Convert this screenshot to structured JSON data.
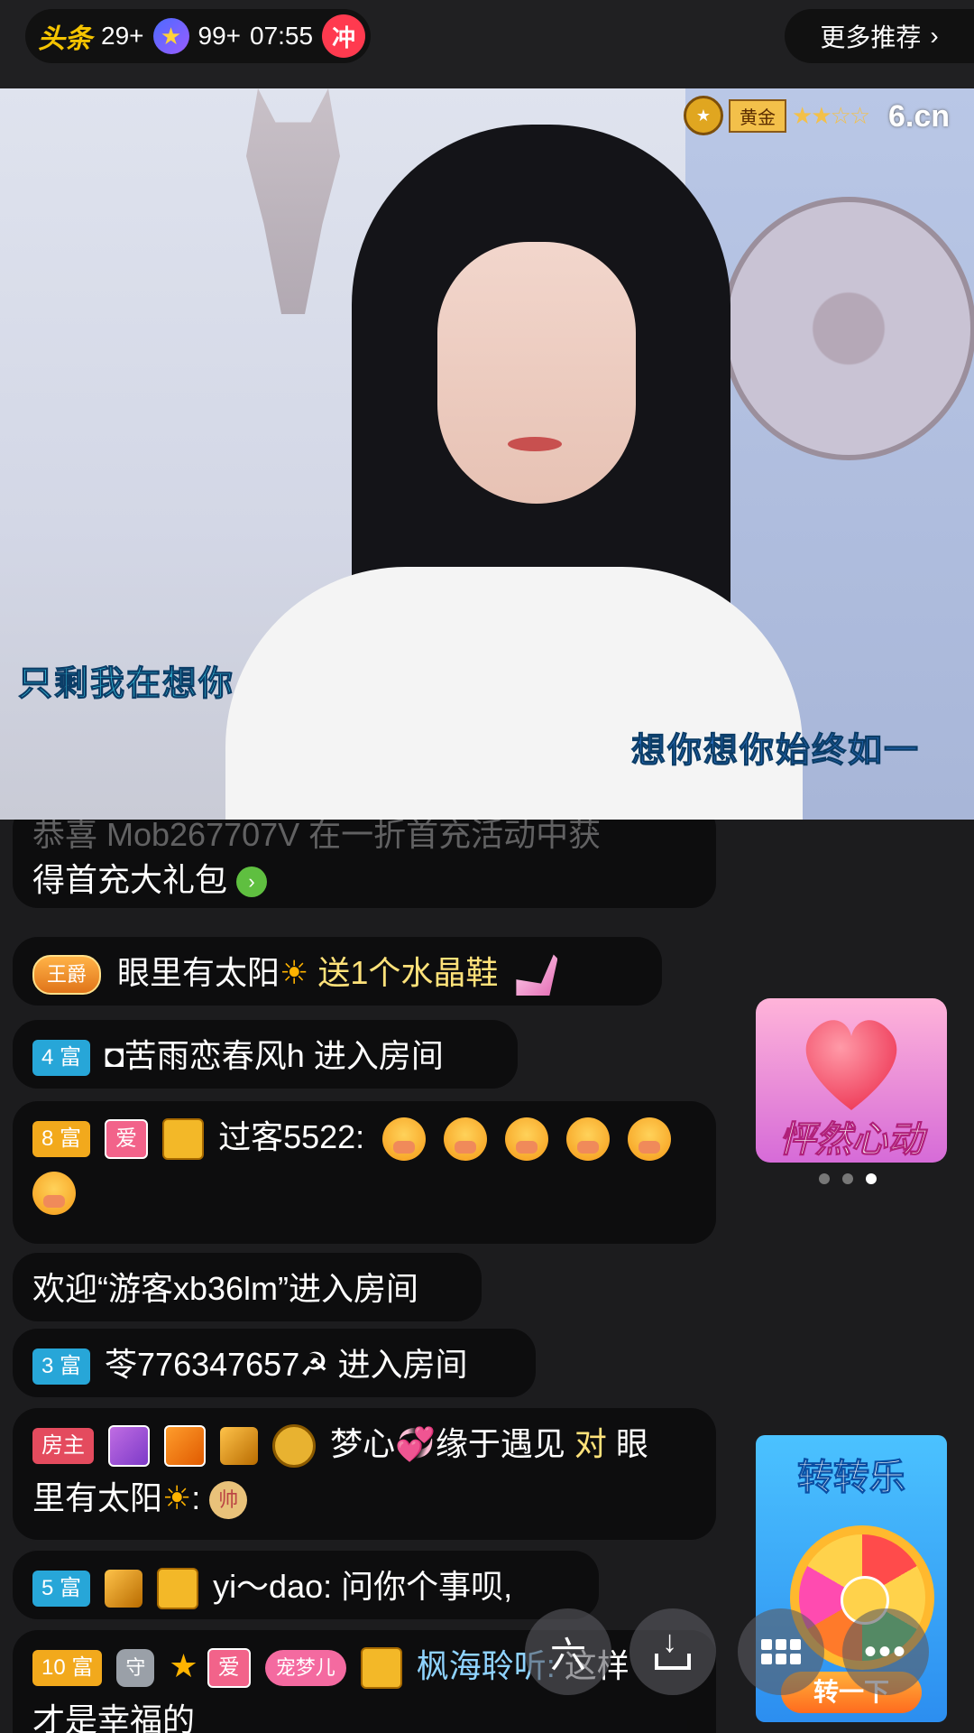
{
  "topbar": {
    "logo_text": "头条",
    "toutiao_count": "29+",
    "star_count": "99+",
    "time": "07:55",
    "rush_label": "冲",
    "more_recommend": "更多推荐",
    "chevron": "›"
  },
  "video": {
    "rank_label": "黄金",
    "rank_stars": "★★☆☆",
    "brand": "6.cn",
    "lyric_left": "只剩我在想你",
    "lyric_right": "想你想你始终如一"
  },
  "chat": {
    "msg1_faded": "恭喜 Mob267707V 在一折首充活动中获",
    "msg1_text": "得首充大礼包",
    "msg2_badge": "王爵",
    "msg2_user": "眼里有太阳",
    "msg2_sun": "☀",
    "msg2_gift": "送1个水晶鞋",
    "msg3_level": "4 富",
    "msg3_user": "◘苦雨恋春风h",
    "msg3_action": "进入房间",
    "msg4_level": "8 富",
    "msg4_tag": "爱",
    "msg4_user": "过客5522:",
    "msg5_text": "欢迎“游客xb36lm”进入房间",
    "msg6_level": "3 富",
    "msg6_user": "苓776347657☭",
    "msg6_action": "进入房间",
    "msg7_tag": "房主",
    "msg7_user": "梦心💞缘于遇见",
    "msg7_to": "对",
    "msg7_target": "眼",
    "msg7_line2": "里有太阳",
    "msg7_chess": "帅",
    "msg8_level": "5 富",
    "msg8_user": "yi～dao:",
    "msg8_text": "问你个事呗,",
    "msg9_level": "10 富",
    "msg9_shield": "守",
    "msg9_tag": "爱",
    "msg9_heart": "宠梦儿",
    "msg9_user": "枫海聆听:",
    "msg9_text": "这样",
    "msg9_line2": "才是幸福的"
  },
  "ads": {
    "heart_title": "怦然心动",
    "wheel_title": "转转乐",
    "wheel_button": "转一下"
  },
  "fabs": {
    "six_label": "六",
    "more_label": "•••"
  }
}
